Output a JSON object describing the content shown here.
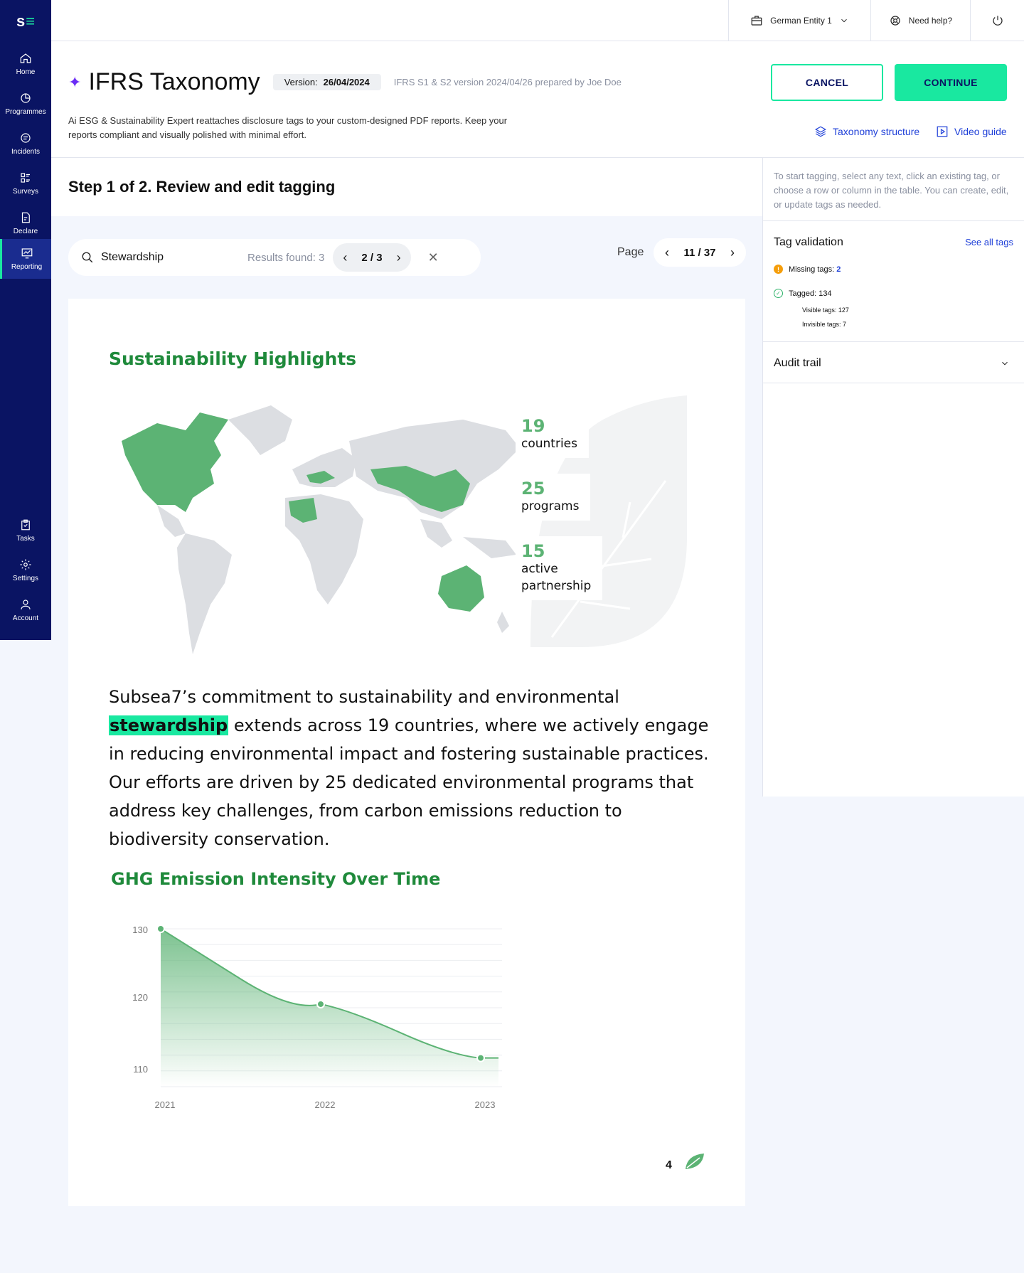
{
  "app": {
    "logo_s": "s",
    "logo_e": "≡"
  },
  "sidebar": {
    "items": [
      {
        "label": "Home"
      },
      {
        "label": "Programmes"
      },
      {
        "label": "Incidents"
      },
      {
        "label": "Surveys"
      },
      {
        "label": "Declare"
      },
      {
        "label": "Reporting",
        "active": true
      }
    ],
    "bottom_items": [
      {
        "label": "Tasks"
      },
      {
        "label": "Settings"
      },
      {
        "label": "Account"
      }
    ]
  },
  "topbar": {
    "entity": "German Entity 1",
    "help": "Need help?"
  },
  "header": {
    "title": "IFRS Taxonomy",
    "version_label": "Version:",
    "version_value": "26/04/2024",
    "version_note": "IFRS S1 & S2 version 2024/04/26 prepared by Joe Doe",
    "description": "Ai ESG & Sustainability Expert reattaches disclosure tags to your custom-designed PDF reports. Keep your reports compliant and visually polished with minimal effort.",
    "cancel_label": "CANCEL",
    "continue_label": "CONTINUE",
    "taxonomy_link": "Taxonomy structure",
    "video_link": "Video guide"
  },
  "step": {
    "title": "Step 1 of 2. Review and edit tagging"
  },
  "search": {
    "value": "Stewardship",
    "results": "Results found: 3",
    "position": "2 / 3"
  },
  "page_nav": {
    "label": "Page",
    "position": "11 / 37"
  },
  "document": {
    "heading": "Sustainability Highlights",
    "stats": [
      {
        "num": "19",
        "label": "countries"
      },
      {
        "num": "25",
        "label": "programs"
      },
      {
        "num": "15",
        "label": "active",
        "label2": "partnership"
      }
    ],
    "para_before": "Subsea7’s commitment to sustainability and environmental ",
    "para_highlight": "stewardship",
    "para_after": " extends across 19 countries, where we actively engage in reducing environmental impact and fostering sustainable practices. Our efforts are driven by 25 dedicated environmental programs that address key challenges, from carbon emissions reduction to biodiversity conservation.",
    "chart_heading": "GHG Emission Intensity Over Time",
    "page_number": "4"
  },
  "chart_data": {
    "type": "area",
    "title": "GHG Emission Intensity Over Time",
    "x": [
      "2021",
      "2022",
      "2023"
    ],
    "series": [
      {
        "values": [
          130,
          119.5,
          112
        ]
      }
    ],
    "y_ticks": [
      130,
      120,
      110
    ],
    "ylim": [
      108,
      130
    ],
    "grid": true,
    "color": "#5cb374"
  },
  "right_panel": {
    "hint": "To start tagging, select any text, click an existing tag, or choose a row or column in the table. You can create, edit, or update tags as needed.",
    "tag_validation_title": "Tag validation",
    "see_all": "See all tags",
    "missing_label": "Missing tags:",
    "missing_count": "2",
    "tagged_label": "Tagged: 134",
    "visible_tags": "Visible tags: 127",
    "invisible_tags": "Invisible tags: 7",
    "audit_trail": "Audit trail"
  },
  "colors": {
    "sidebar": "#0a1463",
    "accent": "#19e8a0",
    "link": "#1e3fd8",
    "doc_green": "#1f8a3b",
    "map_green": "#5cb374"
  }
}
